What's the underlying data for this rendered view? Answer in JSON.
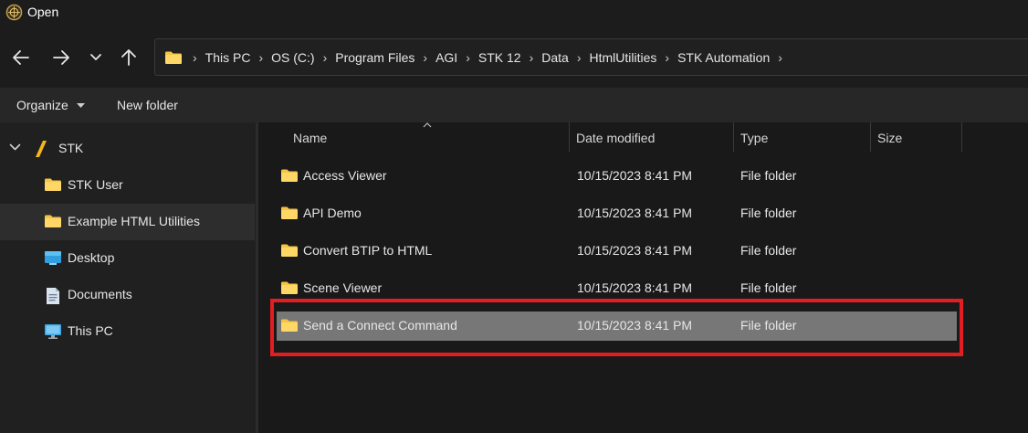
{
  "window": {
    "title": "Open"
  },
  "nav": {
    "back": "back-arrow",
    "forward": "forward-arrow",
    "recent": "chevron-down",
    "up": "up-arrow"
  },
  "breadcrumb": [
    "This PC",
    "OS (C:)",
    "Program Files",
    "AGI",
    "STK 12",
    "Data",
    "HtmlUtilities",
    "STK Automation"
  ],
  "commandbar": {
    "organize": "Organize",
    "new_folder": "New folder"
  },
  "sidebar": {
    "items": [
      {
        "label": "STK",
        "icon": "stk-logo-icon"
      },
      {
        "label": "STK User",
        "icon": "folder-icon"
      },
      {
        "label": "Example HTML Utilities",
        "icon": "folder-icon",
        "selected": true
      },
      {
        "label": "Desktop",
        "icon": "desktop-icon"
      },
      {
        "label": "Documents",
        "icon": "documents-icon"
      },
      {
        "label": "This PC",
        "icon": "computer-icon"
      }
    ]
  },
  "columns": {
    "name": "Name",
    "date": "Date modified",
    "type": "Type",
    "size": "Size"
  },
  "files": [
    {
      "name": "Access Viewer",
      "date": "10/15/2023 8:41 PM",
      "type": "File folder"
    },
    {
      "name": "API Demo",
      "date": "10/15/2023 8:41 PM",
      "type": "File folder"
    },
    {
      "name": "Convert BTIP to HTML",
      "date": "10/15/2023 8:41 PM",
      "type": "File folder"
    },
    {
      "name": "Scene Viewer",
      "date": "10/15/2023 8:41 PM",
      "type": "File folder"
    },
    {
      "name": "Send a Connect Command",
      "date": "10/15/2023 8:41 PM",
      "type": "File folder",
      "selected": true
    }
  ],
  "colors": {
    "highlight": "#e21e22",
    "folder": "#f5c542",
    "selection": "#777777"
  }
}
